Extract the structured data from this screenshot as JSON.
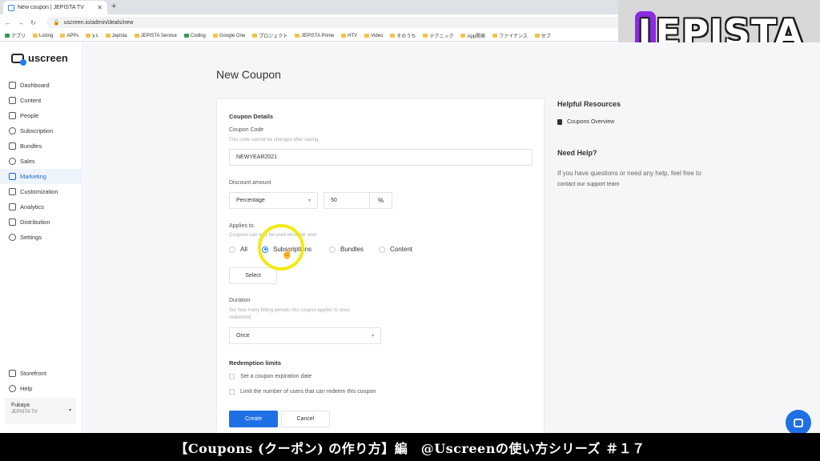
{
  "browser": {
    "tab_title": "New coupon | JEPISTA TV",
    "url": "uscreen.io/admin/deals/new",
    "bookmarks": [
      "アプリ",
      "Listing",
      "APPs",
      "y.c",
      "Jepista",
      "JEPISTA Service",
      "Coding",
      "Google One",
      "プロジェクト",
      "JEPISTA Prime",
      "HTV",
      "Video",
      "そのうち",
      "テクニック",
      "App開発",
      "ファイナンス",
      "セブ"
    ]
  },
  "brand": {
    "text": "JEPISTA",
    "first": "J",
    "rest": "EPISTA"
  },
  "app": {
    "logo": "uscreen",
    "nav": [
      {
        "label": "Dashboard",
        "icon": "dashboard-icon"
      },
      {
        "label": "Content",
        "icon": "folder-icon"
      },
      {
        "label": "People",
        "icon": "people-icon"
      },
      {
        "label": "Subscription",
        "icon": "refresh-icon"
      },
      {
        "label": "Bundles",
        "icon": "box-icon"
      },
      {
        "label": "Sales",
        "icon": "dollar-icon"
      },
      {
        "label": "Marketing",
        "icon": "megaphone-icon"
      },
      {
        "label": "Customization",
        "icon": "edit-icon"
      },
      {
        "label": "Analytics",
        "icon": "chart-icon"
      },
      {
        "label": "Distribution",
        "icon": "share-icon"
      },
      {
        "label": "Settings",
        "icon": "gear-icon"
      }
    ],
    "active_nav": "Marketing",
    "nav_bottom": [
      {
        "label": "Storefront",
        "icon": "store-icon"
      },
      {
        "label": "Help",
        "icon": "help-icon"
      }
    ],
    "user": {
      "name": "Fukaya",
      "org": "JEPISTA TV"
    }
  },
  "page": {
    "title": "New Coupon",
    "details_title": "Coupon Details",
    "code_label": "Coupon Code",
    "code_hint": "This code cannot be changed after saving.",
    "code_value": "NEWYEAR2021",
    "discount_label": "Discount amount",
    "discount_type": "Percentage",
    "discount_value": "50",
    "discount_unit": "%",
    "applies_label": "Applies to",
    "applies_hint": "Coupons can only be used once per user.",
    "applies_options": [
      "All",
      "Subscriptions",
      "Bundles",
      "Content"
    ],
    "applies_selected": "Subscriptions",
    "select_button": "Select",
    "duration_label": "Duration",
    "duration_hint_1": "Set how many billing periods this coupon applies to once",
    "duration_hint_2": "redeemed.",
    "duration_value": "Once",
    "redemption_title": "Redemption limits",
    "check_expiration": "Set a coupon expiration date",
    "check_limit": "Limit the number of users that can redeem this coupon",
    "create_button": "Create",
    "cancel_button": "Cancel"
  },
  "resources": {
    "title": "Helpful Resources",
    "link": "Coupons Overview",
    "help_title": "Need Help?",
    "help_text": "If you have questions or need any help, feel free to",
    "help_link": "contact our support team"
  },
  "caption": "【Coupons (クーポン) の作り方】編　@Uscreenの使い方シリーズ ＃１７",
  "colors": {
    "accent": "#1f6fe5",
    "highlight": "#f2ea14",
    "brand_purple": "#8a2be2"
  }
}
